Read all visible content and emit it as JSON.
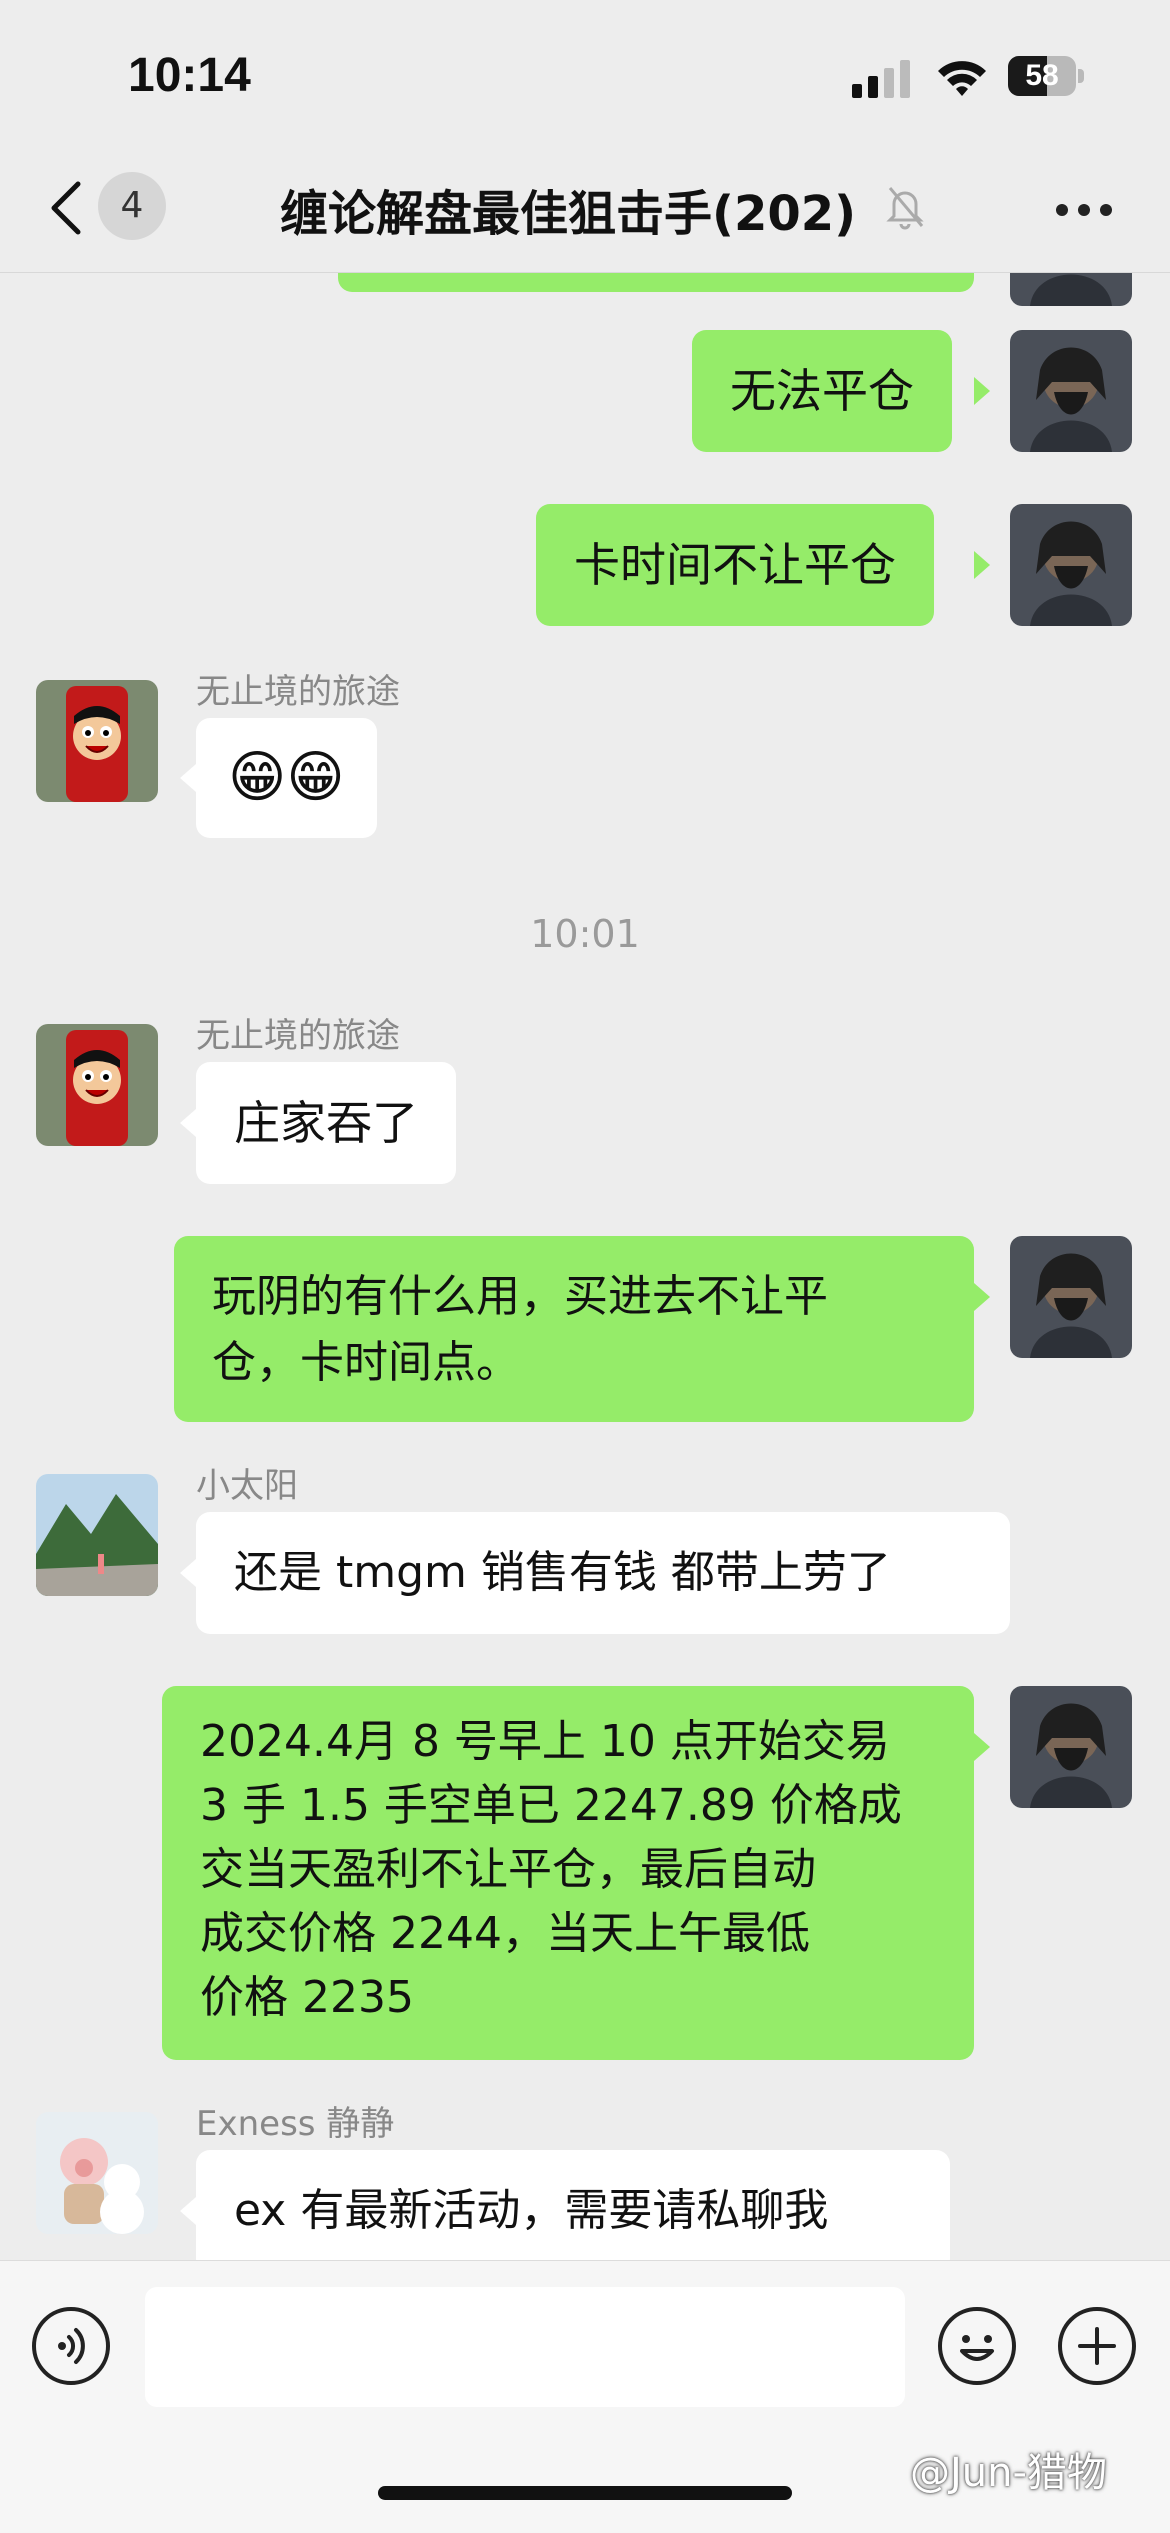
{
  "status_bar": {
    "time": "10:14",
    "battery": "58",
    "battery_level": 0.58
  },
  "nav": {
    "back_count": "4",
    "title": "缠论解盘最佳狙击手(202)"
  },
  "messages": [
    {
      "side": "right",
      "text": "无法平仓"
    },
    {
      "side": "right",
      "text": "卡时间不让平仓"
    },
    {
      "side": "left",
      "sender": "无止境的旅途",
      "text": "😁😁"
    },
    {
      "timestamp": "10:01"
    },
    {
      "side": "left",
      "sender": "无止境的旅途",
      "text": "庄家吞了"
    },
    {
      "side": "right",
      "lines": [
        "玩阴的有什么用，买进去不让平",
        "仓，卡时间点。"
      ]
    },
    {
      "side": "left",
      "sender": "小太阳",
      "text": "还是 tmgm 销售有钱 都带上劳了"
    },
    {
      "side": "right",
      "lines": [
        "2024.4月 8 号早上 10 点开始交易",
        "3 手 1.5 手空单已 2247.89 价格成",
        "交当天盈利不让平仓，最后自动",
        "成交价格 2244，当天上午最低",
        "价格 2235"
      ]
    },
    {
      "side": "left",
      "sender": "Exness 静静",
      "text": "ex 有最新活动，需要请私聊我"
    }
  ],
  "watermark": "@Jun-猎物",
  "colors": {
    "bubble_self": "#95ec69",
    "bubble_other": "#ffffff",
    "background": "#ededed"
  },
  "icons": {
    "voice": "voice-icon",
    "emoji": "emoji-icon",
    "plus": "plus-icon",
    "mute": "bell-slash-icon",
    "more": "more-dots-icon",
    "back": "chevron-left-icon"
  }
}
